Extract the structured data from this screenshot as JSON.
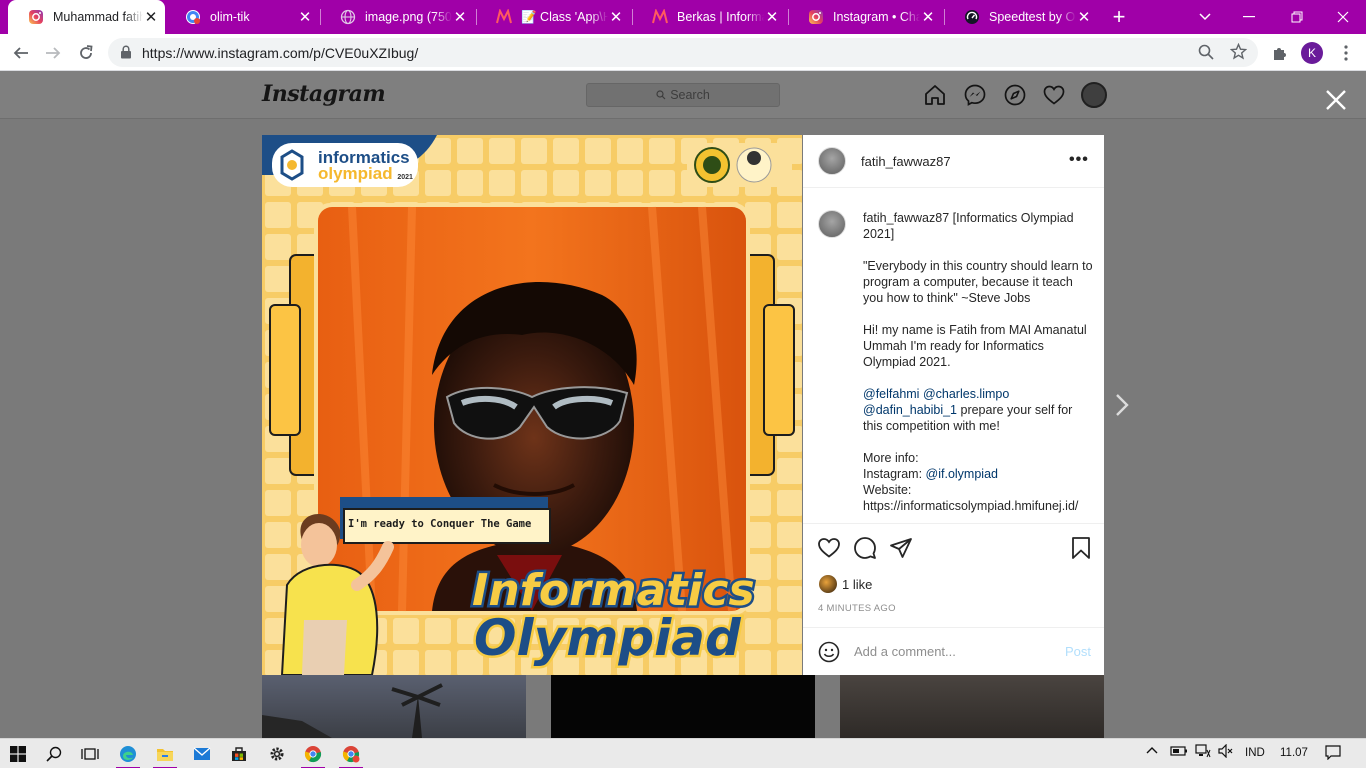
{
  "browser": {
    "tabs": [
      {
        "title": "Muhammad fatih",
        "icon": "instagram-icon",
        "active": true
      },
      {
        "title": "olim-tik",
        "icon": "chrome-app-icon",
        "active": false
      },
      {
        "title": "image.png (750×",
        "icon": "globe-icon",
        "active": false
      },
      {
        "title": "📝 Class 'App\\H",
        "icon": "laravel-icon",
        "active": false
      },
      {
        "title": "Berkas | Informat",
        "icon": "laravel-icon",
        "active": false
      },
      {
        "title": "Instagram • Chat",
        "icon": "instagram-icon",
        "active": false
      },
      {
        "title": "Speedtest by Ook",
        "icon": "speedtest-icon",
        "active": false
      }
    ],
    "url": "https://www.instagram.com/p/CVE0uXZIbug/",
    "profile_initial": "K",
    "accent_color": "#a000a8"
  },
  "instagram": {
    "logo": "Instagram",
    "search_placeholder": "Search",
    "post": {
      "username": "fatih_fawwaz87",
      "caption_title": "[Informatics Olympiad 2021]",
      "quote": "\"Everybody in this country should learn to program a computer, because it teach you how to think\" ~Steve Jobs",
      "intro": "Hi! my name is Fatih from MAI Amanatul Ummah I'm ready for Informatics Olympiad 2021.",
      "mention_1": "@felfahmi",
      "mention_2": "@charles.limpo",
      "mention_3": "@dafin_habibi_1",
      "mentions_tail": " prepare your self for this competition with me!",
      "more_info": "More info:",
      "instagram_label": "Instagram: ",
      "instagram_handle": "@if.olympiad",
      "website_label": "Website:",
      "website": "https://informaticsolympiad.hmifunej.id/",
      "likes": "1 like",
      "time_ago": "4 MINUTES AGO",
      "comment_placeholder": "Add a comment...",
      "post_button": "Post"
    },
    "image": {
      "badge_line1": "informatics",
      "badge_line2": "olympiad",
      "badge_year": "2021",
      "speech": "I'm ready to Conquer The Game",
      "headline_1": "Informatics",
      "headline_2": "Olympiad"
    }
  },
  "taskbar": {
    "language": "IND",
    "time": "11.07"
  }
}
